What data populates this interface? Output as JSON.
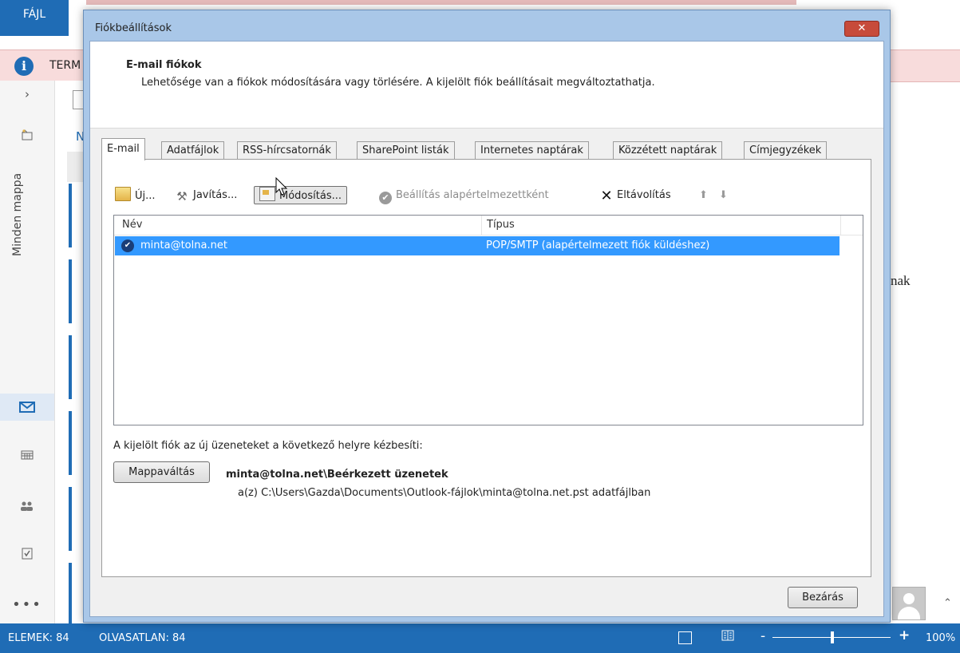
{
  "background": {
    "file_tab": "FÁJL",
    "infobar_text": "TERM",
    "rail": {
      "expand": "›",
      "folder_label": "Minden mappa",
      "more": "•••"
    },
    "mid_letter": "N",
    "right_text": "nak"
  },
  "statusbar": {
    "items": "ELEMEK: 84",
    "unread": "OLVASATLAN: 84",
    "zoom_minus": "-",
    "zoom_plus": "+",
    "zoom_level": "100%"
  },
  "dialog": {
    "title": "Fiókbeállítások",
    "close_glyph": "✕",
    "header_title": "E-mail fiókok",
    "header_desc": "Lehetősége van a fiókok módosítására vagy törlésére. A kijelölt fiók beállításait megváltoztathatja.",
    "tabs": [
      {
        "label": "E-mail"
      },
      {
        "label": "Adatfájlok"
      },
      {
        "label": "RSS-hírcsatornák"
      },
      {
        "label": "SharePoint listák"
      },
      {
        "label": "Internetes naptárak"
      },
      {
        "label": "Közzétett naptárak"
      },
      {
        "label": "Címjegyzékek"
      }
    ],
    "toolbar": {
      "new": "Új...",
      "repair": "Javítás...",
      "change": "Módosítás...",
      "set_default": "Beállítás alapértelmezettként",
      "remove": "Eltávolítás",
      "up": "⬆",
      "down": "⬇"
    },
    "list": {
      "columns": [
        "Név",
        "Típus"
      ],
      "rows": [
        {
          "name": "minta@tolna.net",
          "type": "POP/SMTP (alapértelmezett fiók küldéshez)"
        }
      ]
    },
    "delivery": {
      "label": "A kijelölt fiók az új üzeneteket a következő helyre kézbesíti:",
      "change_folder_button": "Mappaváltás",
      "folder": "minta@tolna.net\\Beérkezett üzenetek",
      "file": "a(z) C:\\Users\\Gazda\\Documents\\Outlook-fájlok\\minta@tolna.net.pst adatfájlban"
    },
    "close_button": "Bezárás"
  },
  "colors": {
    "accent_blue": "#1f6cb5",
    "selection_blue": "#3399ff",
    "infobar_pink": "#f8dcdc",
    "close_red": "#c74b3b"
  }
}
